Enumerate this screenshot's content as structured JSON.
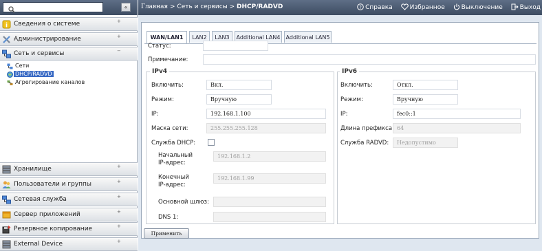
{
  "sidebar": {
    "categories": [
      {
        "label": "Сведения о системе",
        "icon": "info-icon",
        "toggle": "+"
      },
      {
        "label": "Администрирование",
        "icon": "tools-icon",
        "toggle": "+"
      },
      {
        "label": "Сеть и сервисы",
        "icon": "network-icon",
        "toggle": "−"
      },
      {
        "label": "Хранилище",
        "icon": "storage-icon",
        "toggle": "+"
      },
      {
        "label": "Пользователи и группы",
        "icon": "users-icon",
        "toggle": "+"
      },
      {
        "label": "Сетевая служба",
        "icon": "network-service-icon",
        "toggle": "+"
      },
      {
        "label": "Сервер приложений",
        "icon": "app-server-icon",
        "toggle": "+"
      },
      {
        "label": "Резервное копирование",
        "icon": "backup-icon",
        "toggle": "+"
      },
      {
        "label": "External Device",
        "icon": "external-device-icon",
        "toggle": "+"
      }
    ],
    "network_items": [
      {
        "label": "Сети",
        "icon": "network-small-icon"
      },
      {
        "label": "DHCP/RADVD",
        "icon": "dhcp-icon"
      },
      {
        "label": "Агрегирование каналов",
        "icon": "link-aggregation-icon"
      }
    ],
    "collapse_label": "«"
  },
  "topbar": {
    "breadcrumb": {
      "home": "Главная",
      "sep1": " > ",
      "section": "Сеть и сервисы",
      "sep2": " > ",
      "current": "DHCP/RADVD"
    },
    "links": {
      "help": "Справка",
      "favorites": "Избранное",
      "shutdown": "Выключение",
      "logout": "Выход"
    }
  },
  "tabs": [
    "WAN/LAN1",
    "LAN2",
    "LAN3",
    "Additional LAN4",
    "Additional LAN5"
  ],
  "form": {
    "status_label": "Статус:",
    "status_value": "",
    "note_label": "Примечание:",
    "note_value": "",
    "ipv4": {
      "legend": "IPv4",
      "enable_label": "Включить:",
      "enable_value": "Вкл.",
      "mode_label": "Режим:",
      "mode_value": "Вручную",
      "ip_label": "IP:",
      "ip_value": "192.168.1.100",
      "mask_label": "Маска сети:",
      "mask_value": "255.255.255.128",
      "dhcp_label": "Служба DHCP:",
      "start_ip_label": "Начальный IP-адрес:",
      "start_ip_value": "192.168.1.2",
      "end_ip_label": "Конечный IP-адрес:",
      "end_ip_value": "192.168.1.99",
      "gateway_label": "Основной шлюз:",
      "gateway_value": "",
      "dns1_label": "DNS 1:",
      "dns1_value": ""
    },
    "ipv6": {
      "legend": "IPv6",
      "enable_label": "Включить:",
      "enable_value": "Откл.",
      "mode_label": "Режим:",
      "mode_value": "Вручную",
      "ip_label": "IP:",
      "ip_value": "fec0::1",
      "prefix_label": "Длина префикса:",
      "prefix_value": "64",
      "radvd_label": "Служба RADVD:",
      "radvd_value": "Недопустимо"
    },
    "apply_label": "Применить"
  },
  "colors": {
    "topbar": "#4a5a72",
    "main_bg": "#dfe7f0",
    "selection": "#3869c4"
  }
}
